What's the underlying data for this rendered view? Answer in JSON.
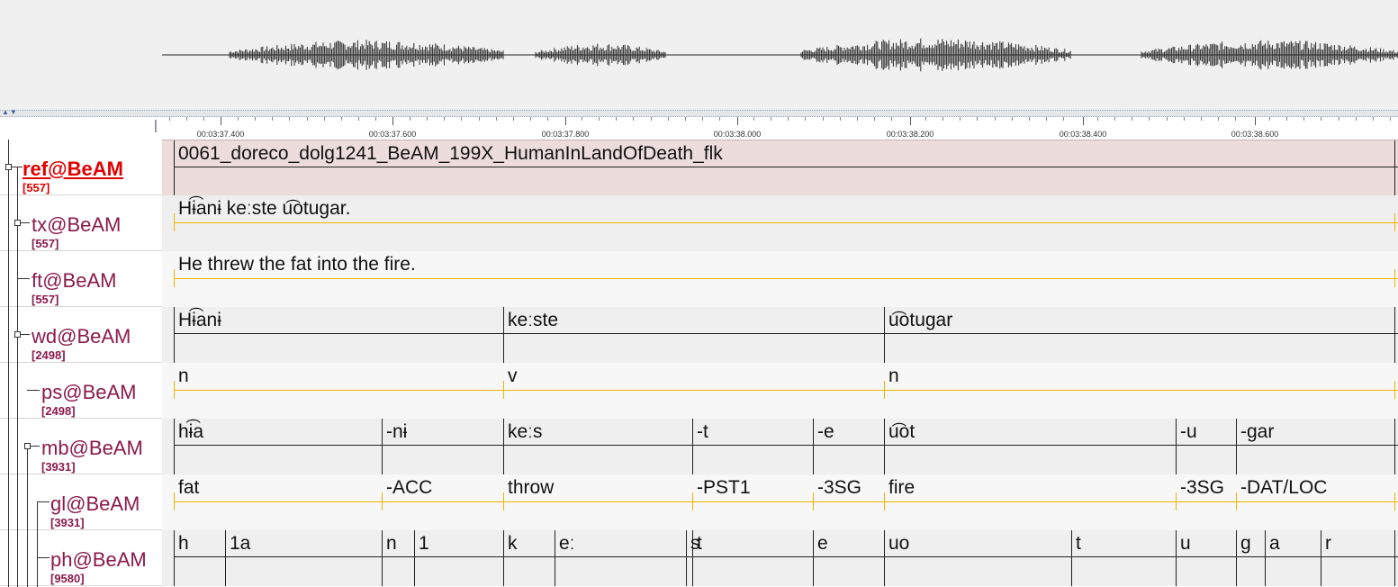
{
  "timeline": {
    "ticks": [
      "00:03:37.400",
      "00:03:37.600",
      "00:03:37.800",
      "00:03:38.000",
      "00:03:38.200",
      "00:03:38.400",
      "00:03:38.600"
    ]
  },
  "tiers": [
    {
      "name": "ref@BeAM",
      "count": "[557]",
      "active": true
    },
    {
      "name": "tx@BeAM",
      "count": "[557]"
    },
    {
      "name": "ft@BeAM",
      "count": "[557]"
    },
    {
      "name": "wd@BeAM",
      "count": "[2498]"
    },
    {
      "name": "ps@BeAM",
      "count": "[2498]"
    },
    {
      "name": "mb@BeAM",
      "count": "[3931]"
    },
    {
      "name": "gl@BeAM",
      "count": "[3931]"
    },
    {
      "name": "ph@BeAM",
      "count": "[9580]"
    }
  ],
  "annotations": {
    "ref": [
      "0061_doreco_dolg1241_BeAM_199X_HumanInLandOfDeath_flk"
    ],
    "tx": [
      "Hɨ͡anɨ keːste u͡otugar."
    ],
    "ft": [
      "He threw the fat into the fire."
    ],
    "wd": [
      "Hɨ͡anɨ",
      "keːste",
      "u͡otugar"
    ],
    "ps": [
      "n",
      "v",
      "n"
    ],
    "mb": [
      "hɨ͡a",
      "-nɨ",
      "keːs",
      "-t",
      "-e",
      "u͡ot",
      "-u",
      "-gar"
    ],
    "gl": [
      "fat",
      "-ACC",
      "throw",
      "-PST1",
      "-3SG",
      "fire",
      "-3SG",
      "-DAT/LOC"
    ],
    "ph": [
      "h",
      "1a",
      "n",
      "1",
      "k",
      "eː",
      "s",
      "t",
      "e",
      "uo",
      "t",
      "u",
      "g",
      "a",
      "r"
    ]
  },
  "colors": {
    "tier_name": "#8b1a4a",
    "active_tier": "#e00000",
    "ref_track": "#ecdcdc",
    "symbolic_line": "#f0b400"
  }
}
